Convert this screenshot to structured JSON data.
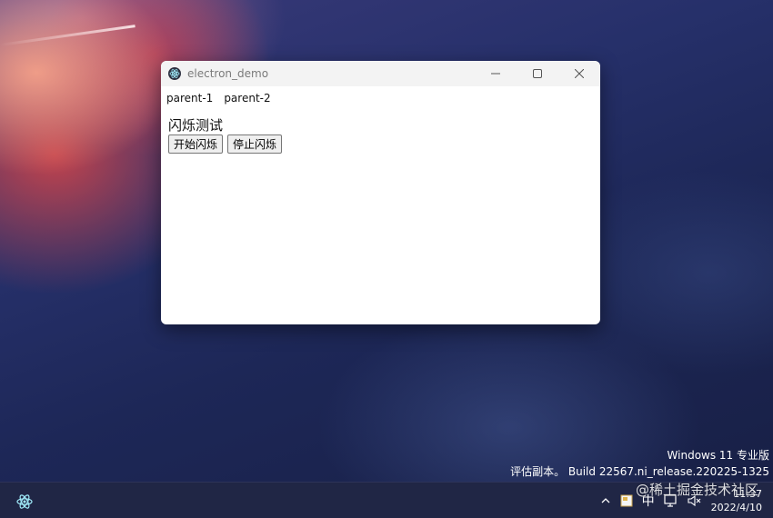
{
  "window": {
    "title": "electron_demo",
    "menu": [
      "parent-1",
      "parent-2"
    ],
    "heading": "闪烁测试",
    "buttons": {
      "start": "开始闪烁",
      "stop": "停止闪烁"
    }
  },
  "desktop": {
    "watermark_line1": "Windows 11 专业版",
    "watermark_line2": "评估副本。 Build 22567.ni_release.220225-1325"
  },
  "taskbar": {
    "input_method": "中",
    "clock_time": "11:37",
    "clock_date": "2022/4/10",
    "corner_watermark": "@稀土掘金技术社区"
  },
  "icons": {
    "app": "electron-icon",
    "minimize": "minimize-icon",
    "maximize": "maximize-icon",
    "close": "close-icon",
    "tray_chevron": "chevron-up-icon",
    "tray_app": "app-tray-icon",
    "network": "network-icon",
    "volume": "volume-muted-icon"
  }
}
